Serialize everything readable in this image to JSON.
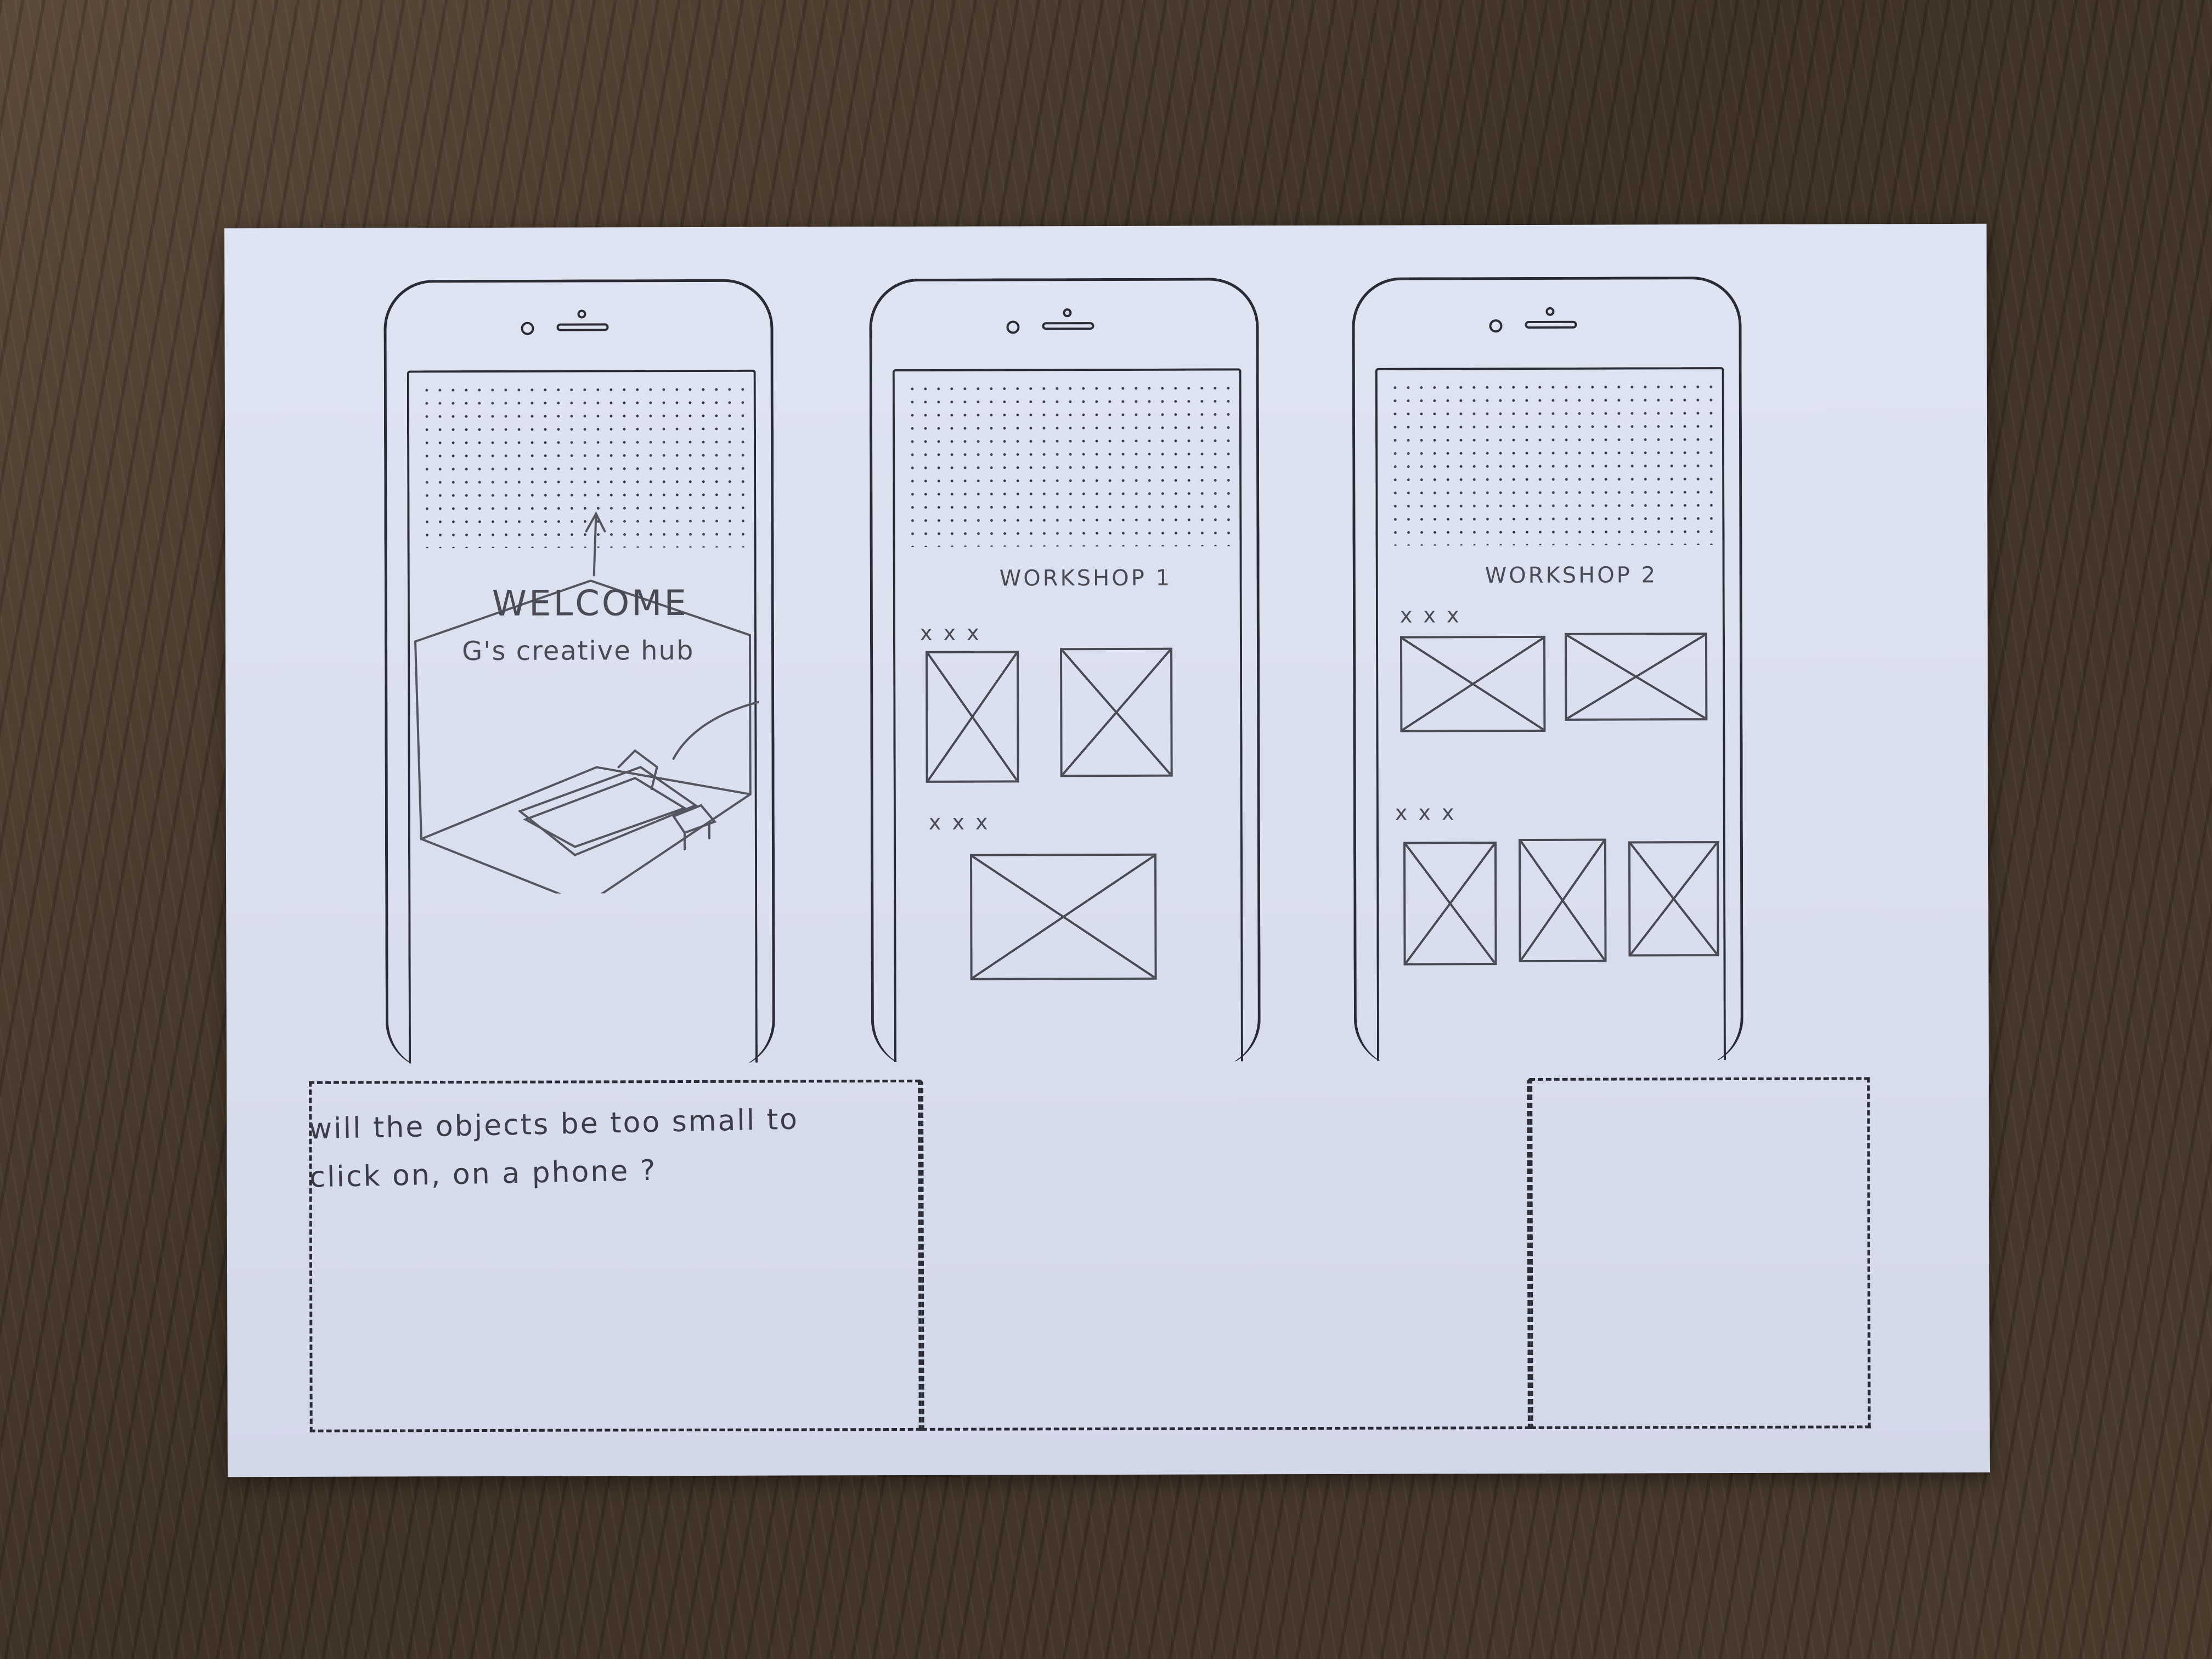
{
  "screens": [
    {
      "welcome_title": "WELCOME",
      "welcome_subtitle": "G's creative hub"
    },
    {
      "title": "WORKSHOP 1",
      "groups": [
        {
          "caption": "x x x"
        },
        {
          "caption": "x x x"
        }
      ]
    },
    {
      "title": "WORKSHOP 2",
      "groups": [
        {
          "caption": "x x x"
        },
        {
          "caption": "x x x"
        }
      ]
    }
  ],
  "note": "will the objects be too small to click on, on a phone ?",
  "colors": {
    "ink": "#2b2b35",
    "pencil": "#4a4a55",
    "paper": "#dfe4f3",
    "wood": "#4a3b2d"
  }
}
